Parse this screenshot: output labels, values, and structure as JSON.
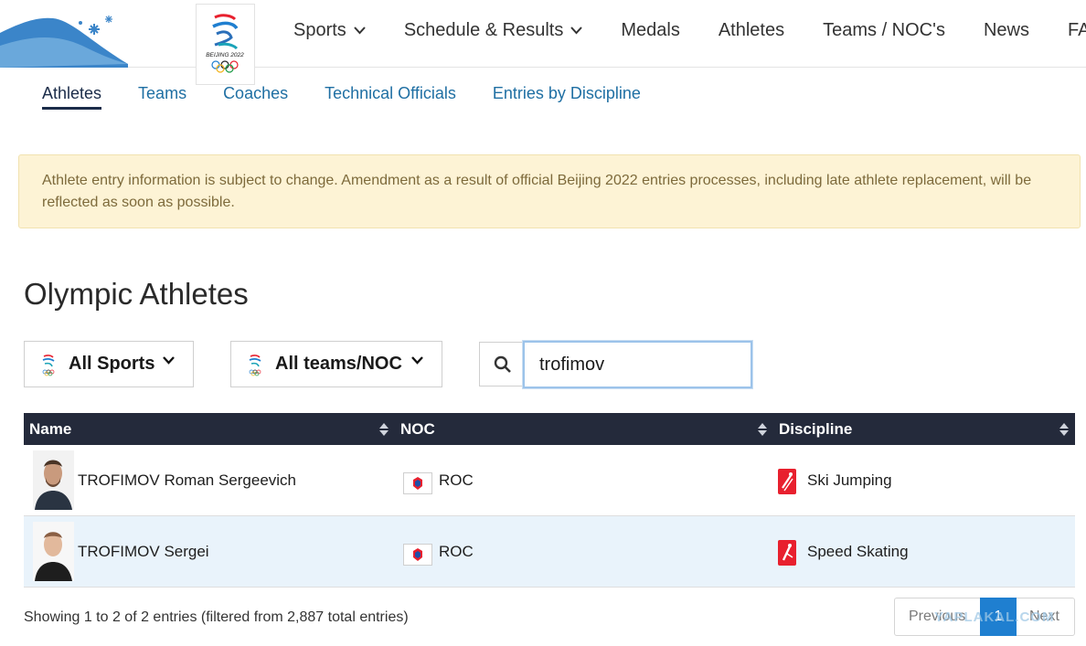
{
  "header": {
    "logo_text": "BEIJING 2022",
    "nav": [
      {
        "label": "Sports",
        "dropdown": true
      },
      {
        "label": "Schedule & Results",
        "dropdown": true
      },
      {
        "label": "Medals",
        "dropdown": false
      },
      {
        "label": "Athletes",
        "dropdown": false
      },
      {
        "label": "Teams / NOC's",
        "dropdown": false
      },
      {
        "label": "News",
        "dropdown": false
      },
      {
        "label": "FA",
        "dropdown": false
      }
    ]
  },
  "subtabs": [
    {
      "label": "Athletes",
      "active": true
    },
    {
      "label": "Teams",
      "active": false
    },
    {
      "label": "Coaches",
      "active": false
    },
    {
      "label": "Technical Officials",
      "active": false
    },
    {
      "label": "Entries by Discipline",
      "active": false
    }
  ],
  "notice": "Athlete entry information is subject to change. Amendment as a result of official Beijing 2022 entries processes, including late athlete replacement, will be reflected as soon as possible.",
  "page_title": "Olympic Athletes",
  "filters": {
    "sports": "All Sports",
    "noc": "All teams/NOC"
  },
  "search": {
    "value": "trofimov"
  },
  "table": {
    "headers": {
      "name": "Name",
      "noc": "NOC",
      "discipline": "Discipline"
    },
    "rows": [
      {
        "name": "TROFIMOV Roman Sergeevich",
        "noc": "ROC",
        "discipline": "Ski Jumping",
        "icon": "ski-jumping-icon"
      },
      {
        "name": "TROFIMOV Sergei",
        "noc": "ROC",
        "discipline": "Speed Skating",
        "icon": "speed-skating-icon"
      }
    ]
  },
  "footer": {
    "info": "Showing 1 to 2 of 2 entries (filtered from 2,887 total entries)",
    "prev": "Previous",
    "page": "1",
    "next": "Next"
  },
  "watermark": "YAPLAKAL.COM",
  "colors": {
    "header_dark": "#242a3b",
    "accent_blue": "#1f7fd0",
    "link_blue": "#1f6fa3",
    "notice_bg": "#fdf3d5",
    "row_alt": "#e9f3fb",
    "discipline_red": "#e8202e"
  }
}
